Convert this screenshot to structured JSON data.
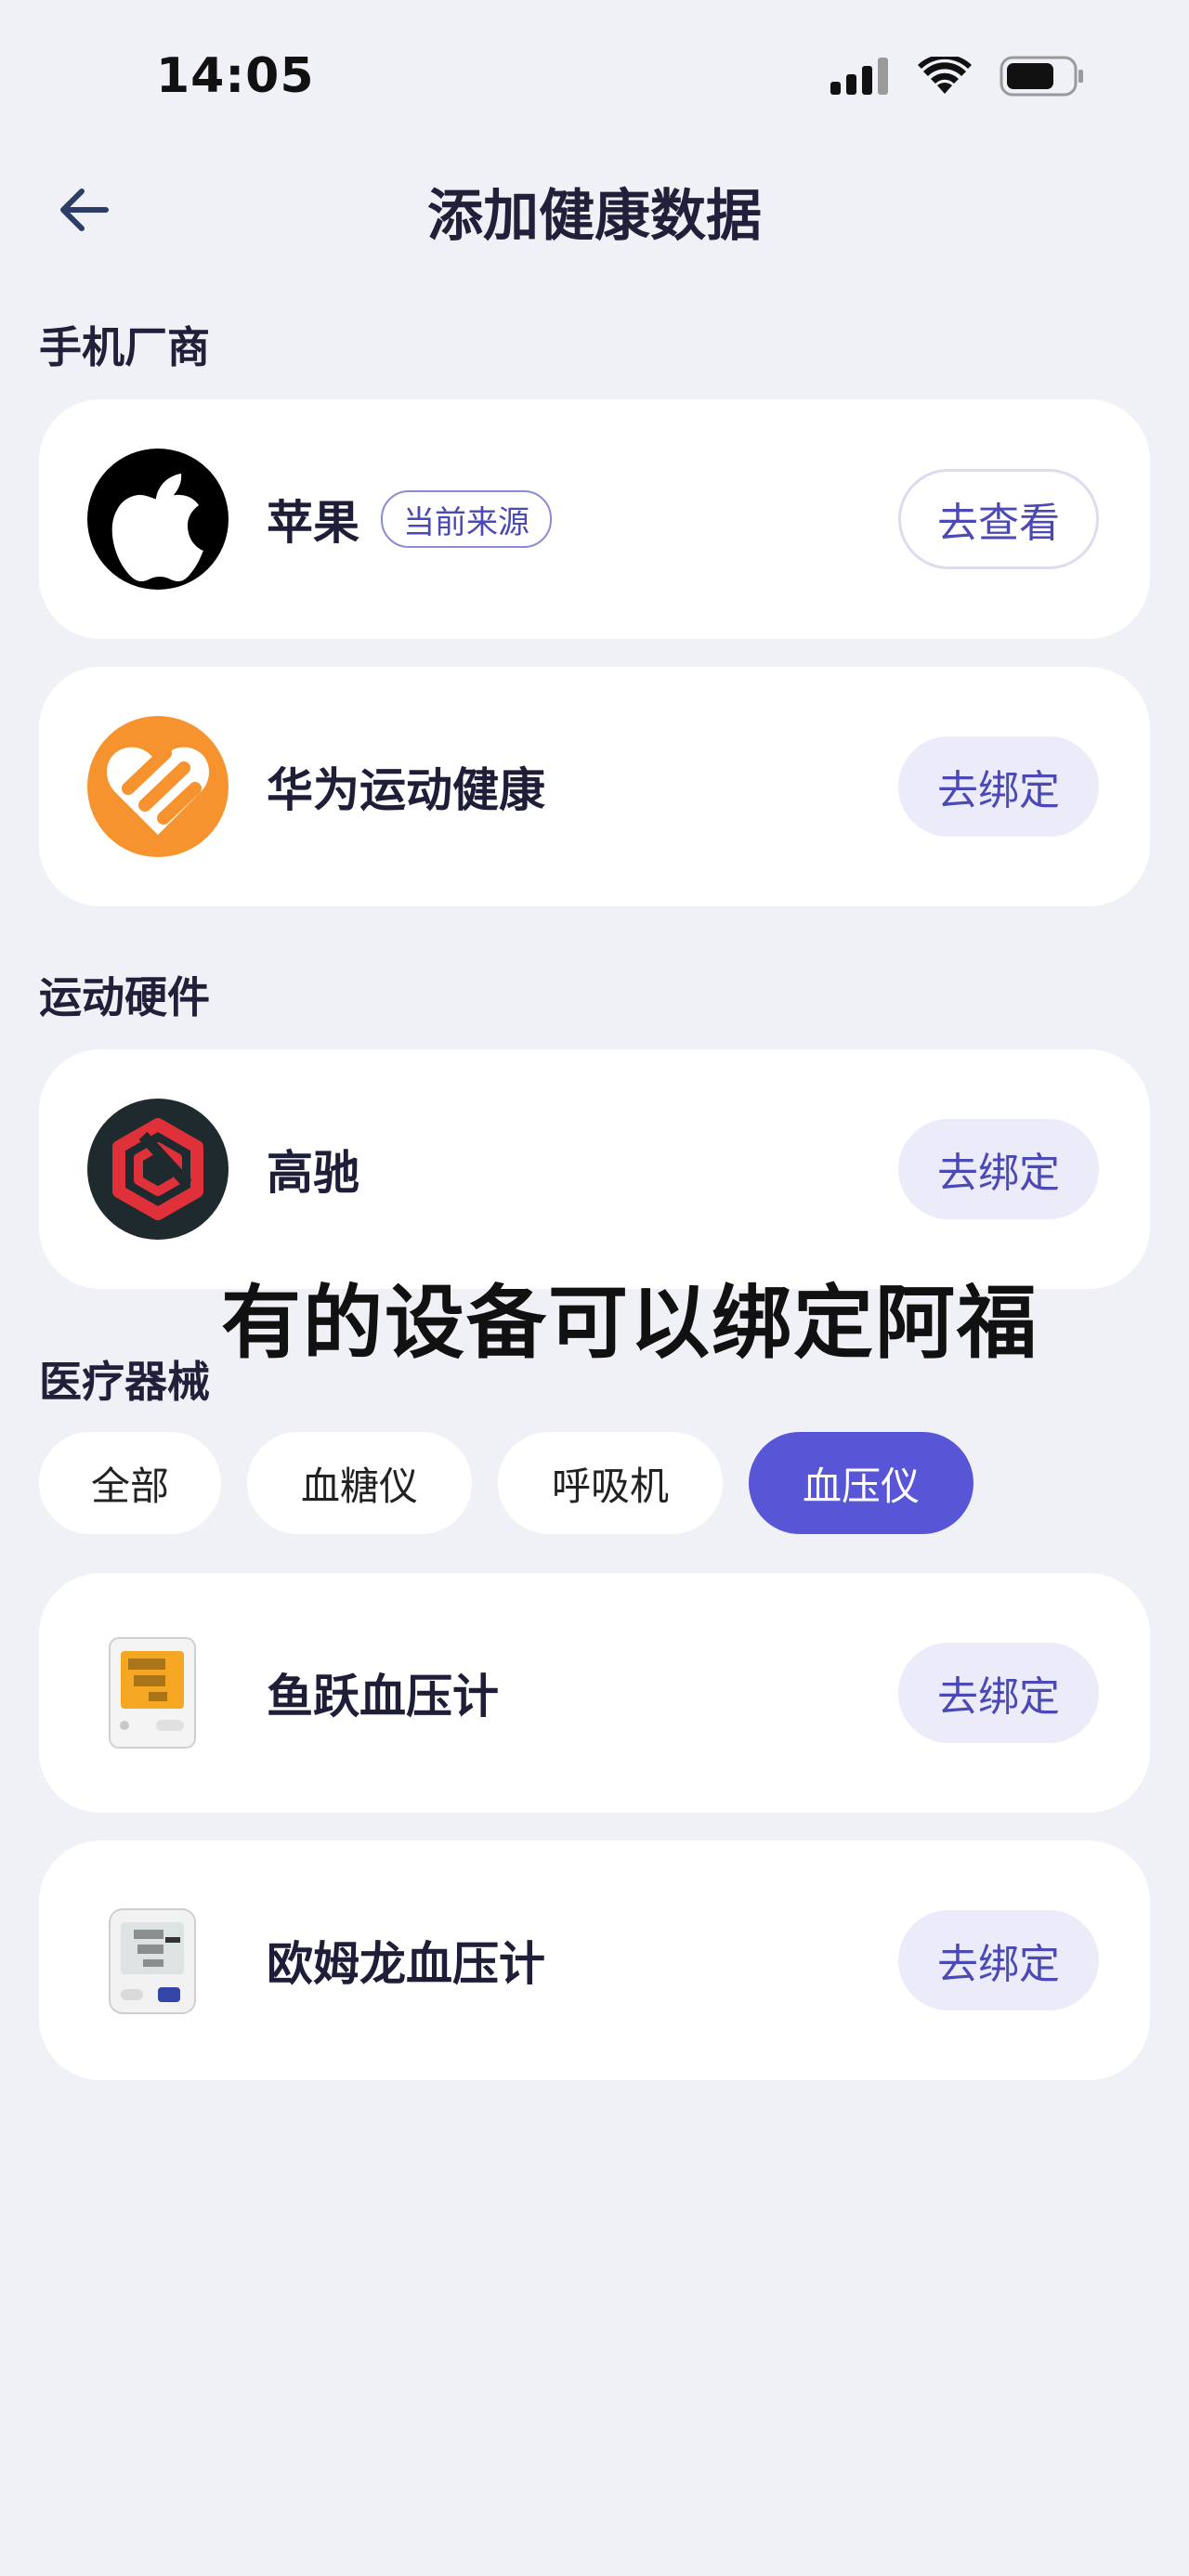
{
  "status_bar": {
    "time": "14:05"
  },
  "header": {
    "title": "添加健康数据"
  },
  "sections": {
    "phone_vendors": "手机厂商",
    "sports_hardware": "运动硬件",
    "medical_devices": "医疗器械"
  },
  "phone_vendors": [
    {
      "name": "苹果",
      "badge": "当前来源",
      "action": "去查看"
    },
    {
      "name": "华为运动健康",
      "action": "去绑定"
    }
  ],
  "sports_hardware": [
    {
      "name": "高驰",
      "action": "去绑定"
    }
  ],
  "filter_chips": [
    {
      "label": "全部",
      "selected": false
    },
    {
      "label": "血糖仪",
      "selected": false
    },
    {
      "label": "呼吸机",
      "selected": false
    },
    {
      "label": "血压仪",
      "selected": true
    }
  ],
  "medical_devices": [
    {
      "name": "鱼跃血压计",
      "action": "去绑定"
    },
    {
      "name": "欧姆龙血压计",
      "action": "去绑定"
    }
  ],
  "overlay_caption": "有的设备可以绑定阿福",
  "colors": {
    "accent": "#5856D6",
    "button_bg": "#EBEBFA",
    "page_bg": "#F0F1F6",
    "huawei_orange": "#F7932E",
    "coros_red": "#E0313A"
  },
  "icons": [
    "back-arrow-icon",
    "signal-icon",
    "wifi-icon",
    "battery-icon",
    "apple-logo-icon",
    "huawei-health-logo-icon",
    "coros-logo-icon"
  ]
}
